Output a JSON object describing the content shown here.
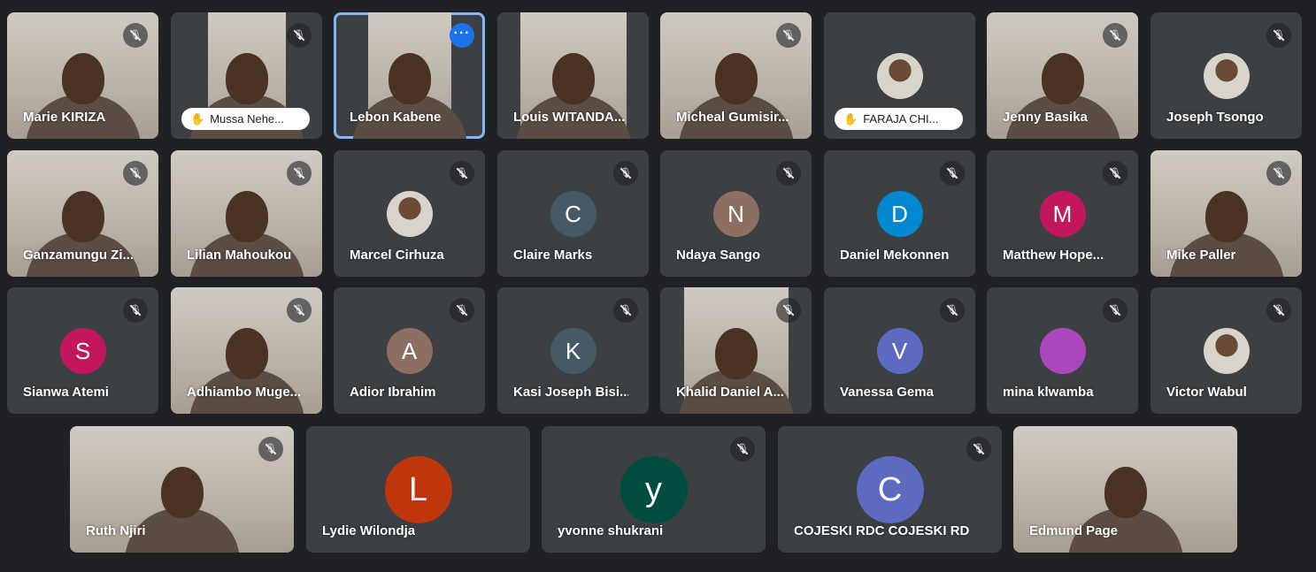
{
  "participants": [
    {
      "name": "Marie KIRIZA",
      "type": "video",
      "muted": true
    },
    {
      "name": "Mussa Nehe...",
      "type": "video",
      "muted": true,
      "hand_raised": true
    },
    {
      "name": "Lebon Kabene",
      "type": "video",
      "active": true,
      "menu_icon": "more-options-icon"
    },
    {
      "name": "Louis WITANDA...",
      "type": "video",
      "muted": false
    },
    {
      "name": "Micheal Gumisir...",
      "type": "video",
      "muted": true
    },
    {
      "name": "FARAJA CHI...",
      "type": "avatar-photo",
      "muted": false,
      "hand_raised": true
    },
    {
      "name": "Jenny Basika",
      "type": "video",
      "muted": true
    },
    {
      "name": "Joseph Tsongo",
      "type": "avatar-photo",
      "muted": true
    },
    {
      "name": "Ganzamungu Zi...",
      "type": "video",
      "muted": true
    },
    {
      "name": "Lilian Mahoukou",
      "type": "video",
      "muted": true
    },
    {
      "name": "Marcel Cirhuza",
      "type": "avatar-photo",
      "muted": true
    },
    {
      "name": "Claire Marks",
      "type": "avatar",
      "initial": "C",
      "color": "#455a64",
      "muted": true
    },
    {
      "name": "Ndaya Sango",
      "type": "avatar",
      "initial": "N",
      "color": "#8d6e63",
      "muted": true
    },
    {
      "name": "Daniel Mekonnen",
      "type": "avatar",
      "initial": "D",
      "color": "#0288d1",
      "muted": true
    },
    {
      "name": "Matthew Hope...",
      "type": "avatar",
      "initial": "M",
      "color": "#c2185b",
      "muted": true
    },
    {
      "name": "Mike Paller",
      "type": "video",
      "muted": true
    },
    {
      "name": "Sianwa Atemi",
      "type": "avatar",
      "initial": "S",
      "color": "#c2185b",
      "muted": true
    },
    {
      "name": "Adhiambo Muge...",
      "type": "video",
      "muted": true
    },
    {
      "name": "Adior Ibrahim",
      "type": "avatar",
      "initial": "A",
      "color": "#8d6e63",
      "muted": true
    },
    {
      "name": "Kasi Joseph Bisi...",
      "type": "avatar",
      "initial": "K",
      "color": "#455a64",
      "muted": true
    },
    {
      "name": "Khalid Daniel A...",
      "type": "video",
      "muted": true
    },
    {
      "name": "Vanessa Gema",
      "type": "avatar",
      "initial": "V",
      "color": "#5c6bc0",
      "muted": true
    },
    {
      "name": "mina klwamba",
      "type": "avatar",
      "initial": "",
      "color": "#ab47bc",
      "muted": true
    },
    {
      "name": "Victor Wabul",
      "type": "avatar-photo",
      "muted": true
    },
    {
      "name": "Ruth Njiri",
      "type": "video",
      "muted": true
    },
    {
      "name": "Lydie Wilondja",
      "type": "avatar",
      "initial": "L",
      "color": "#bf360c",
      "muted": false
    },
    {
      "name": "yvonne shukrani",
      "type": "avatar",
      "initial": "y",
      "color": "#004d40",
      "muted": true
    },
    {
      "name": "COJESKI RDC COJESKI RD",
      "type": "avatar",
      "initial": "C",
      "color": "#5c6bc0",
      "muted": true
    },
    {
      "name": "Edmund Page",
      "type": "video",
      "muted": false
    }
  ],
  "icons": {
    "mic_off": "mic-off-icon",
    "hand": "raised-hand-icon",
    "more": "more-options-icon"
  },
  "colors": {
    "background": "#202124",
    "tile": "#3c4043",
    "active_outline": "#8ab4f8"
  }
}
